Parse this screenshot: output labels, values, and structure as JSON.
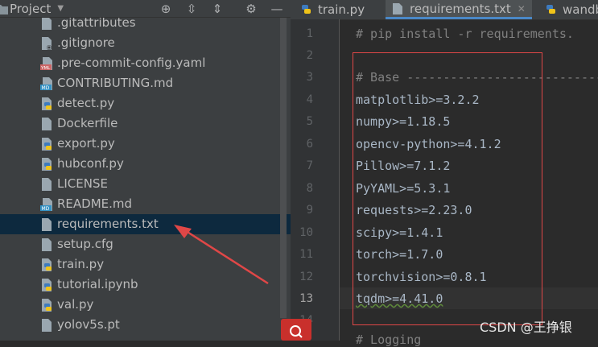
{
  "project_panel": {
    "title": "Project",
    "files": [
      {
        "name": ".gitattributes",
        "type": "text"
      },
      {
        "name": ".gitignore",
        "type": "gitignore"
      },
      {
        "name": ".pre-commit-config.yaml",
        "type": "yaml"
      },
      {
        "name": "CONTRIBUTING.md",
        "type": "markdown"
      },
      {
        "name": "detect.py",
        "type": "python"
      },
      {
        "name": "Dockerfile",
        "type": "text"
      },
      {
        "name": "export.py",
        "type": "python"
      },
      {
        "name": "hubconf.py",
        "type": "python"
      },
      {
        "name": "LICENSE",
        "type": "text"
      },
      {
        "name": "README.md",
        "type": "markdown"
      },
      {
        "name": "requirements.txt",
        "type": "text"
      },
      {
        "name": "setup.cfg",
        "type": "text"
      },
      {
        "name": "train.py",
        "type": "python"
      },
      {
        "name": "tutorial.ipynb",
        "type": "python"
      },
      {
        "name": "val.py",
        "type": "python"
      },
      {
        "name": "yolov5s.pt",
        "type": "text"
      }
    ],
    "selected_file": "requirements.txt"
  },
  "editor": {
    "tabs": [
      {
        "label": "train.py",
        "icon": "python-file-icon",
        "active": false
      },
      {
        "label": "requirements.txt",
        "icon": "text-file-icon",
        "active": true
      },
      {
        "label": "wandb",
        "icon": "python-file-icon",
        "active": false
      }
    ],
    "line_numbers": [
      "1",
      "2",
      "3",
      "4",
      "5",
      "6",
      "7",
      "8",
      "9",
      "10",
      "11",
      "12",
      "13",
      "14"
    ],
    "current_line": "13",
    "lines": [
      "# pip install -r requirements.",
      "",
      "# Base ----------------------------",
      "matplotlib>=3.2.2",
      "numpy>=1.18.5",
      "opencv-python>=4.1.2",
      "Pillow>=7.1.2",
      "PyYAML>=5.3.1",
      "requests>=2.23.0",
      "scipy>=1.4.1",
      "torch>=1.7.0",
      "torchvision>=0.8.1",
      "tqdm>=4.41.0",
      "",
      "# Logging"
    ]
  },
  "watermark": "CSDN @王挣银",
  "colors": {
    "annotation": "#e04747",
    "selection": "#0d293e",
    "accent": "#4a88c7"
  }
}
